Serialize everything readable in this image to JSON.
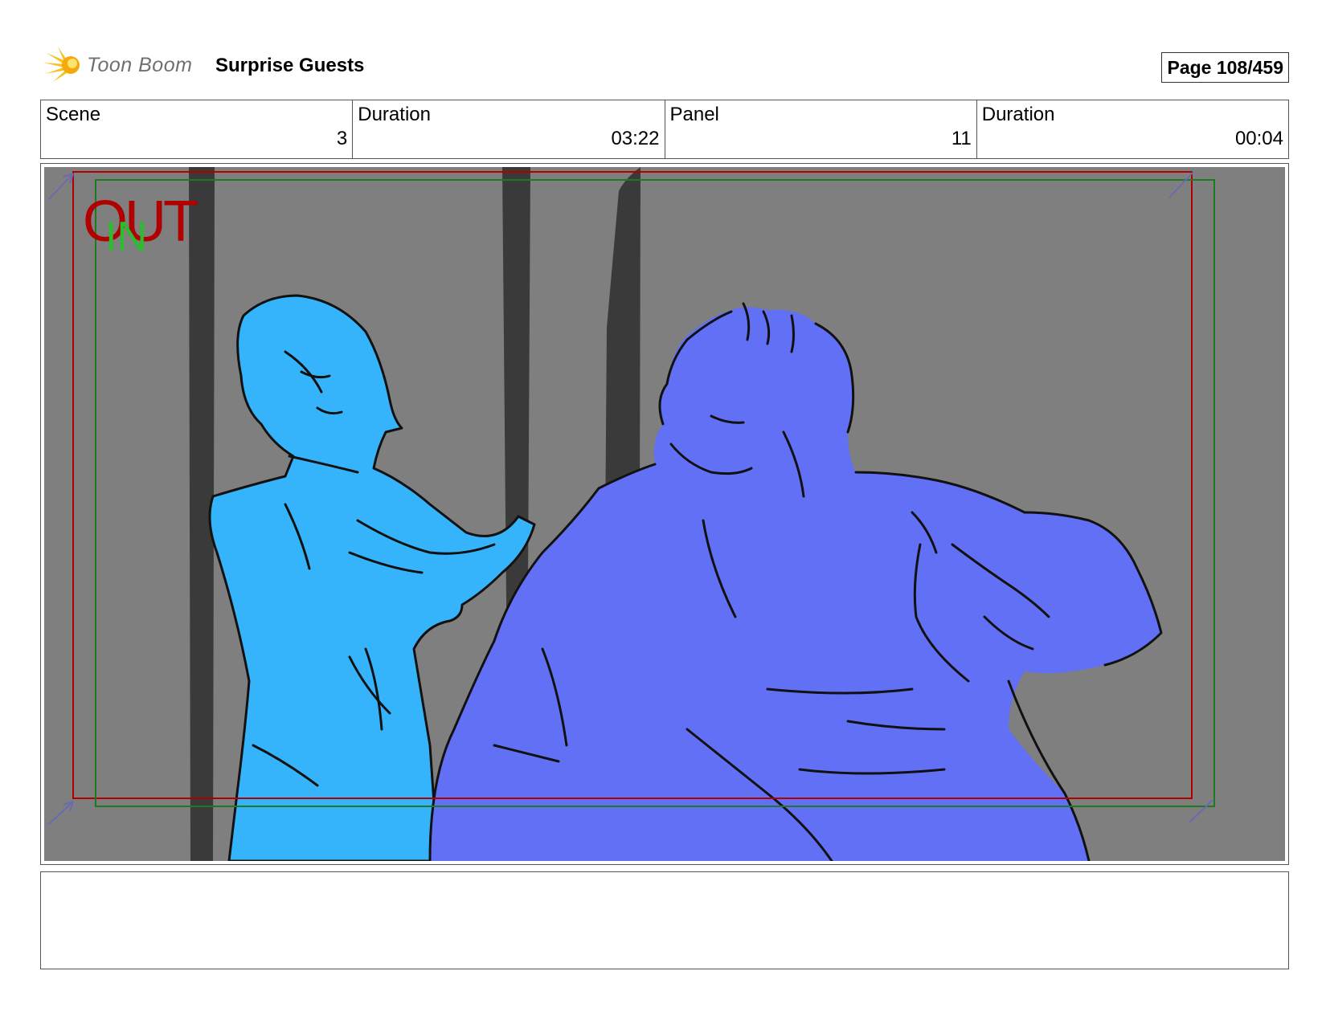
{
  "header": {
    "logo_text": "Toon Boom",
    "title": "Surprise Guests",
    "page_label": "Page 108/459"
  },
  "info": {
    "scene_label": "Scene",
    "scene_value": "3",
    "scene_duration_label": "Duration",
    "scene_duration_value": "03:22",
    "panel_label": "Panel",
    "panel_value": "11",
    "panel_duration_label": "Duration",
    "panel_duration_value": "00:04"
  },
  "panel": {
    "out_marker": "OUT",
    "in_marker": "IN",
    "background_color": "#7f7f7f",
    "figure_left_color": "#36b4fb",
    "figure_right_color": "#6270f5",
    "out_frame_color": "#b00000",
    "in_frame_color": "#1f7a1f"
  },
  "notes": {
    "text": ""
  }
}
